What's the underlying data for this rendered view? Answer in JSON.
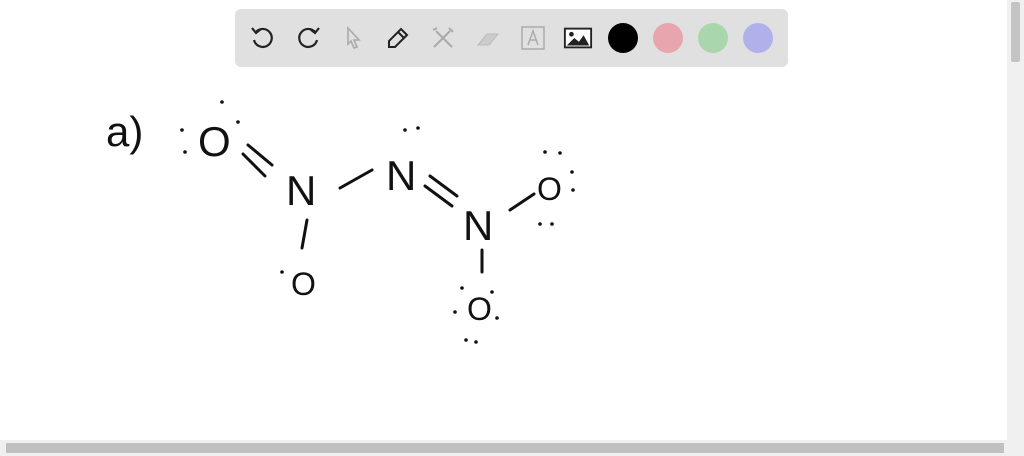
{
  "toolbar": {
    "tools": [
      "undo",
      "redo",
      "select",
      "pen",
      "tools",
      "eraser",
      "text",
      "image"
    ],
    "colors": [
      "#000000",
      "#e8a5ad",
      "#a9d6ad",
      "#b0b0ea"
    ]
  },
  "drawing": {
    "label": "a)",
    "atoms": [
      "O",
      "N",
      "O",
      "N",
      "N",
      "O",
      "O"
    ]
  }
}
